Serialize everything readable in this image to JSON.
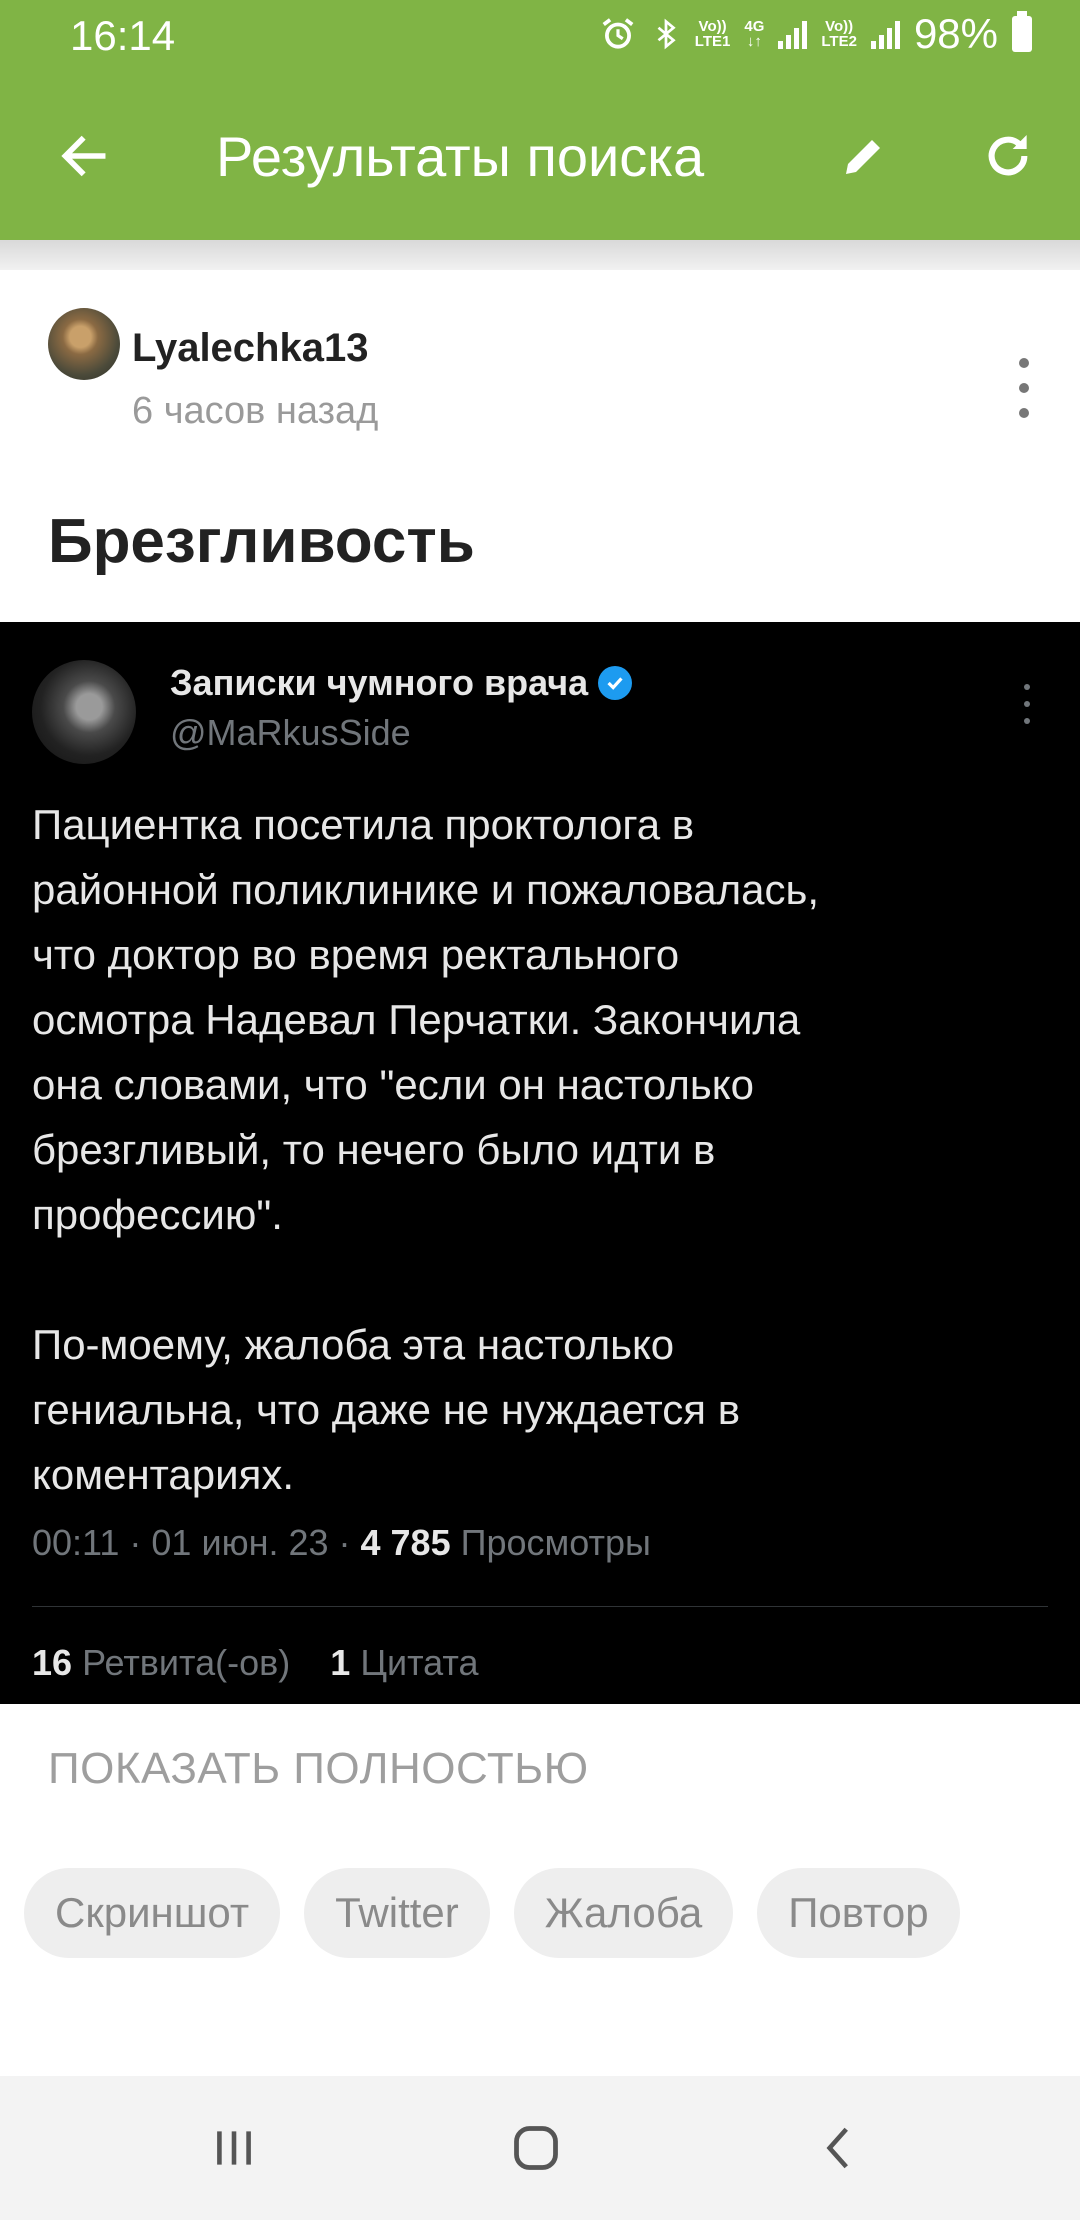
{
  "status_bar": {
    "time": "16:14",
    "sim1_label_top": "Vo))",
    "sim1_label_bottom": "LTE1",
    "network_type": "4G",
    "sim2_label_top": "Vo))",
    "sim2_label_bottom": "LTE2",
    "battery": "98%"
  },
  "app_bar": {
    "title": "Результаты поиска",
    "back_icon": "arrow-left-icon",
    "edit_icon": "pencil-icon",
    "refresh_icon": "refresh-icon",
    "color": "#80b445"
  },
  "post": {
    "author": "Lyalechka13",
    "time_ago": "6 часов назад",
    "title": "Брезгливость"
  },
  "tweet": {
    "author_name": "Записки чумного врача",
    "handle": "@MaRkusSide",
    "paragraph1": [
      "Пациентка посетила проктолога в",
      "районной поликлинике и пожаловалась,",
      "что доктор во время ректального",
      "осмотра Надевал Перчатки. Закончила",
      "она словами, что \"если он настолько",
      "брезгливый, то нечего было идти в",
      "профессию\"."
    ],
    "paragraph2": [
      "По-моему, жалоба эта настолько",
      "гениальна, что даже не нуждается в",
      "коментариях."
    ],
    "timestamp": "00:11 · 01 июн. 23 ·",
    "views_count": "4 785",
    "views_label": "Просмотры",
    "retweets_count": "16",
    "retweets_label": "Ретвита(-ов)",
    "quotes_count": "1",
    "quotes_label": "Цитата"
  },
  "show_full_label": "ПОКАЗАТЬ ПОЛНОСТЬЮ",
  "tags": [
    "Скриншот",
    "Twitter",
    "Жалоба",
    "Повтор"
  ],
  "nav_bar": {
    "recents_icon": "recent-apps-icon",
    "home_icon": "home-icon",
    "back_icon": "back-chevron-icon"
  }
}
